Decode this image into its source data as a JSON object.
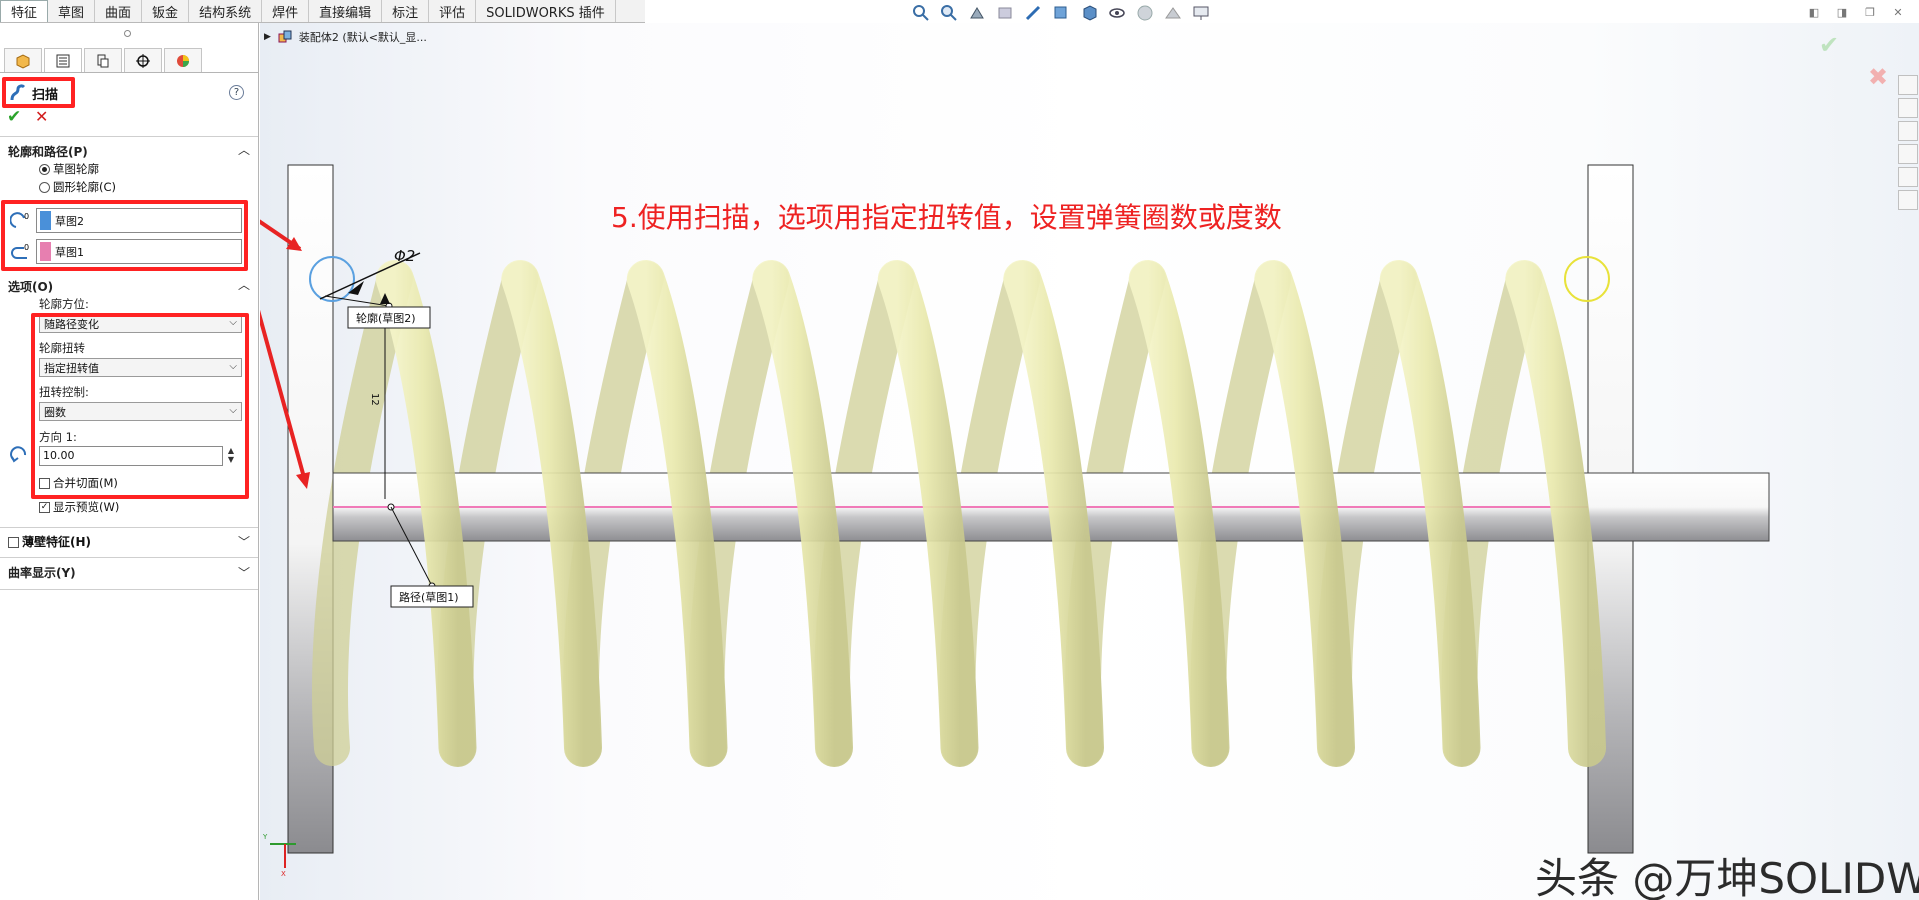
{
  "tabs": [
    "特征",
    "草图",
    "曲面",
    "钣金",
    "结构系统",
    "焊件",
    "直接编辑",
    "标注",
    "评估",
    "SOLIDWORKS 插件"
  ],
  "tree": {
    "label": "装配体2 (默认<默认_显..."
  },
  "feature": {
    "title": "扫描",
    "help": "?",
    "ok": "✔",
    "cancel": "✕",
    "profile_path": {
      "header": "轮廓和路径(P)",
      "radio_sketch": "草图轮廓",
      "radio_circle": "圆形轮廓(C)",
      "profile_value": "草图2",
      "path_value": "草图1",
      "profile_color": "#4a90d9",
      "path_color": "#e77fb0"
    },
    "options": {
      "header": "选项(O)",
      "orientation_label": "轮廓方位:",
      "orientation_value": "随路径变化",
      "twist_label": "轮廓扭转",
      "twist_value": "指定扭转值",
      "twist_control_label": "扭转控制:",
      "twist_control_value": "圈数",
      "direction_label": "方向 1:",
      "direction_value": "10.00",
      "merge_label": "合并切面(M)",
      "preview_label": "显示预览(W)",
      "preview_checked": true
    },
    "thin": {
      "label": "薄壁特征(H)"
    },
    "curvature": {
      "label": "曲率显示(Y)"
    }
  },
  "viewport": {
    "annotation": "5.使用扫描，选项用指定扭转值，设置弹簧圈数或度数",
    "dimension_label": "Φ2",
    "dim_small": "12",
    "profile_callout": "轮廓(草图2)",
    "path_callout": "路径(草图1)",
    "watermark": "头条 @万坤SOLIDWORKS",
    "spring_coils": 10,
    "spring_color": "#e6e6a6"
  }
}
